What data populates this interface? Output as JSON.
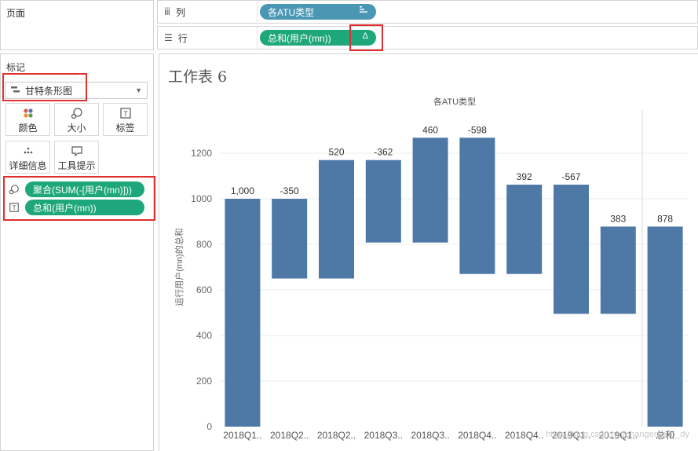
{
  "left_panel": {
    "pages_title": "页面",
    "marks_title": "标记",
    "mark_type": "甘特条形图",
    "mark_buttons": [
      {
        "label": "颜色",
        "icon": "color-dots-icon"
      },
      {
        "label": "大小",
        "icon": "size-icon"
      },
      {
        "label": "标签",
        "icon": "label-icon"
      },
      {
        "label": "详细信息",
        "icon": "detail-icon"
      },
      {
        "label": "工具提示",
        "icon": "tooltip-icon"
      }
    ],
    "encodings": [
      {
        "icon": "size-icon",
        "pill": "聚合(SUM(-[用户(mn)]))"
      },
      {
        "icon": "label-icon",
        "pill": "总和(用户(mn))"
      }
    ]
  },
  "shelves": {
    "columns": {
      "label": "列",
      "pill": "各ATU类型",
      "pill_icon": "sort-icon"
    },
    "rows": {
      "label": "行",
      "pill": "总和(用户(mn))",
      "pill_icon": "Δ"
    }
  },
  "worksheet": {
    "title": "工作表 6"
  },
  "chart_data": {
    "type": "bar",
    "subtype": "waterfall-gantt",
    "title": "各ATU类型",
    "xlabel": "",
    "ylabel": "运行用户(mn)的总和",
    "ylim": [
      0,
      1300
    ],
    "yticks": [
      0,
      200,
      400,
      600,
      800,
      1000,
      1200
    ],
    "grid": true,
    "bar_color": "#4e79a7",
    "categories": [
      "2018Q1..",
      "2018Q2..",
      "2018Q2..",
      "2018Q3..",
      "2018Q3..",
      "2018Q4..",
      "2018Q4..",
      "2019Q1..",
      "2019Q1..",
      "总和"
    ],
    "labels": [
      "1,000",
      "-350",
      "520",
      "-362",
      "460",
      "-598",
      "392",
      "-567",
      "383",
      "878"
    ],
    "values": [
      1000,
      -350,
      520,
      -362,
      460,
      -598,
      392,
      -567,
      383,
      878
    ],
    "bar_start": [
      0,
      1000,
      650,
      1170,
      808,
      1268,
      670,
      1062,
      495,
      0
    ],
    "bar_end": [
      1000,
      650,
      1170,
      808,
      1268,
      670,
      1062,
      495,
      878,
      878
    ]
  },
  "watermark": "https://blog.csdn.net/changerzhuo_dy"
}
